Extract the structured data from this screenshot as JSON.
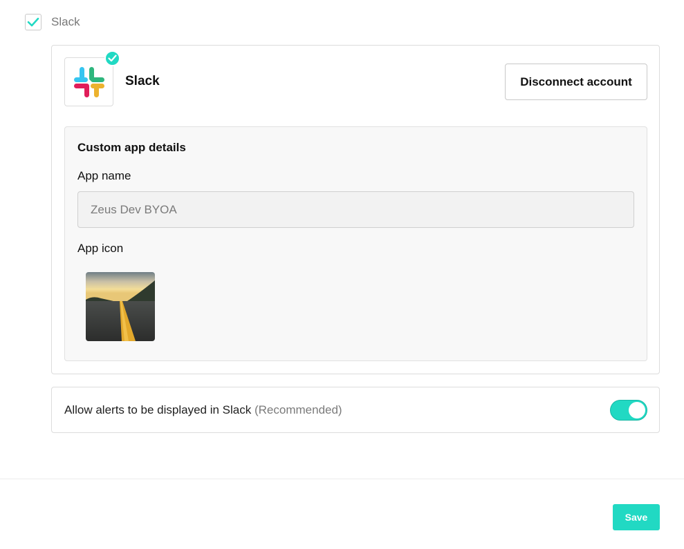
{
  "integration": {
    "checkbox_label": "Slack",
    "checked": true
  },
  "app_card": {
    "title": "Slack",
    "logo_icon": "slack-logo-icon",
    "badge_icon": "check-circle-icon",
    "disconnect_label": "Disconnect account"
  },
  "custom_app": {
    "heading": "Custom app details",
    "name_label": "App name",
    "name_value": "Zeus Dev BYOA",
    "icon_label": "App icon",
    "icon_image": "road-photo-thumbnail"
  },
  "alerts": {
    "text": "Allow alerts to be displayed in Slack",
    "note": "(Recommended)",
    "enabled": true
  },
  "footer": {
    "save_label": "Save"
  },
  "colors": {
    "accent": "#21d9c3",
    "slack_blue": "#36c5f0",
    "slack_green": "#2eb67d",
    "slack_red": "#e01e5a",
    "slack_yellow": "#ecb22e"
  }
}
